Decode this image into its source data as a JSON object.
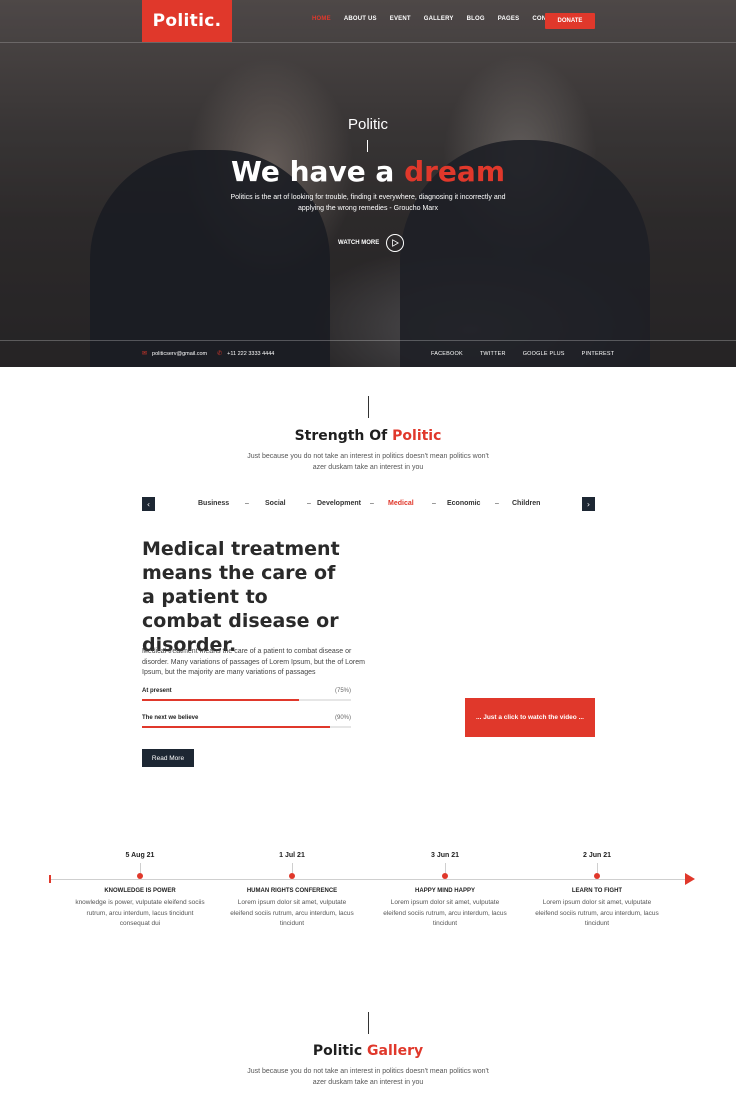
{
  "brand": {
    "logo": "Politic.",
    "accent": "#e0382b",
    "dark": "#1d2733"
  },
  "nav": {
    "items": [
      "HOME",
      "ABOUT US",
      "EVENT",
      "GALLERY",
      "BLOG",
      "PAGES",
      "CONTACT"
    ],
    "donate": "DONATE"
  },
  "hero": {
    "subtitle": "Politic",
    "title_main": "We have a ",
    "title_accent": "dream",
    "text": "Politics is the art of looking for trouble, finding it everywhere, diagnosing it incorrectly and applying the wrong remedies - Groucho Marx",
    "watch_label": "WATCH MORE"
  },
  "contact": {
    "email": "politicserv@gmail.com",
    "phone": "+11 222 3333 4444"
  },
  "social": [
    "FACEBOOK",
    "TWITTER",
    "GOOGLE PLUS",
    "PINTEREST"
  ],
  "strength": {
    "title_main": "Strength Of ",
    "title_accent": "Politic",
    "subtitle": "Just because you do not take an interest in politics doesn't mean politics won't azer duskam take an interest in you",
    "tabs": [
      "Business",
      "Social",
      "Development",
      "Medical",
      "Economic",
      "Children"
    ],
    "active_tab": "Medical",
    "heading": "Medical treatment means the care of a patient to combat disease or disorder.",
    "body": "Medical treatment means the care of a patient to combat disease or disorder. Many variations of passages of Lorem Ipsum, but the of Lorem Ipsum, but the majority are many variations of passages",
    "bars": [
      {
        "label": "At present",
        "pct_label": "(75%)",
        "value": 0.75
      },
      {
        "label": "The next we believe",
        "pct_label": "(90%)",
        "value": 0.9
      }
    ],
    "read_more": "Read More",
    "video_cta": "... Just a click to watch the video ..."
  },
  "timeline": [
    {
      "date": "5 Aug 21",
      "title": "KNOWLEDGE IS POWER",
      "text": "knowledge is power, vulputate eleifend sociis rutrum, arcu interdum, lacus tincidunt consequat dui"
    },
    {
      "date": "1 Jul 21",
      "title": "HUMAN RIGHTS CONFERENCE",
      "text": "Lorem ipsum dolor sit amet, vulputate eleifend sociis rutrum, arcu interdum, lacus tincidunt"
    },
    {
      "date": "3 Jun 21",
      "title": "HAPPY MIND HAPPY",
      "text": "Lorem ipsum dolor sit amet, vulputate eleifend sociis rutrum, arcu interdum, lacus tincidunt"
    },
    {
      "date": "2 Jun 21",
      "title": "LEARN TO FIGHT",
      "text": "Lorem ipsum dolor sit amet, vulputate eleifend sociis rutrum, arcu interdum, lacus tincidunt"
    }
  ],
  "gallery": {
    "title_main": "Politic ",
    "title_accent": "Gallery",
    "subtitle": "Just because you do not take an interest in politics doesn't mean politics won't azer duskam take an interest in you"
  }
}
